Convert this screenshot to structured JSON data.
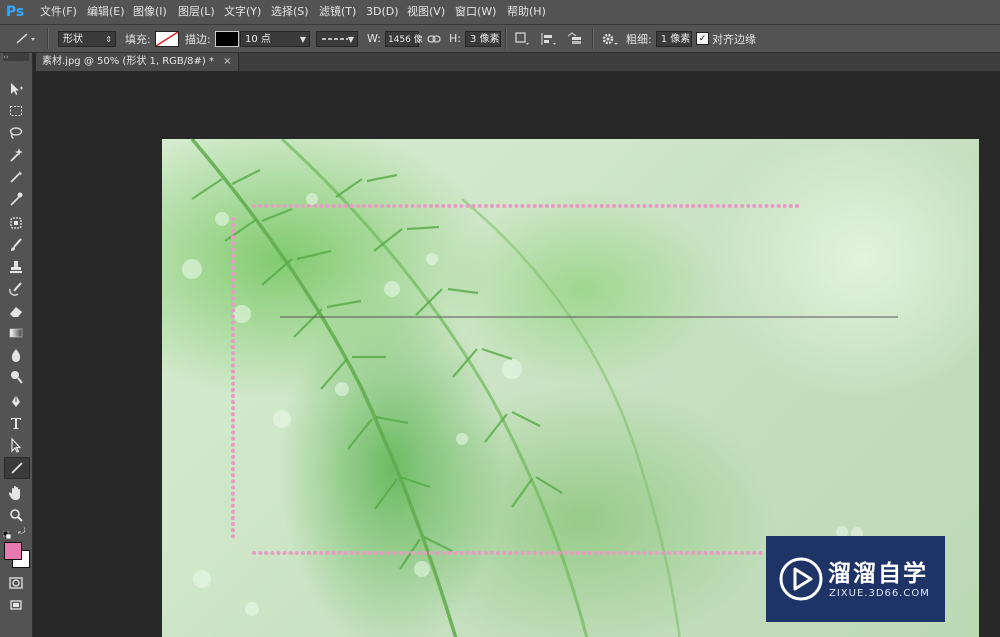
{
  "app": {
    "logo": "Ps"
  },
  "menu": [
    "文件(F)",
    "编辑(E)",
    "图像(I)",
    "图层(L)",
    "文字(Y)",
    "选择(S)",
    "滤镜(T)",
    "3D(D)",
    "视图(V)",
    "窗口(W)",
    "帮助(H)"
  ],
  "options": {
    "mode_value": "形状",
    "fill_label": "填充:",
    "stroke_label": "描边:",
    "stroke_size_value": "10 点",
    "w_label": "W:",
    "w_value": "1456 像",
    "h_label": "H:",
    "h_value": "3 像素",
    "weight_label": "粗细:",
    "weight_value": "1 像素",
    "align_edges_label": "对齐边缘",
    "align_edges_checked": true
  },
  "document": {
    "tab_title": "素材.jpg @ 50% (形状 1, RGB/8#) *",
    "close_glyph": "×"
  },
  "watermark": {
    "title": "溜溜自学",
    "url": "ZIXUE.3D66.COM"
  },
  "colors": {
    "foreground": "#e87ab0",
    "background": "#ffffff",
    "dotted_line": "#e89cc4",
    "accent": "#31a8ff"
  }
}
